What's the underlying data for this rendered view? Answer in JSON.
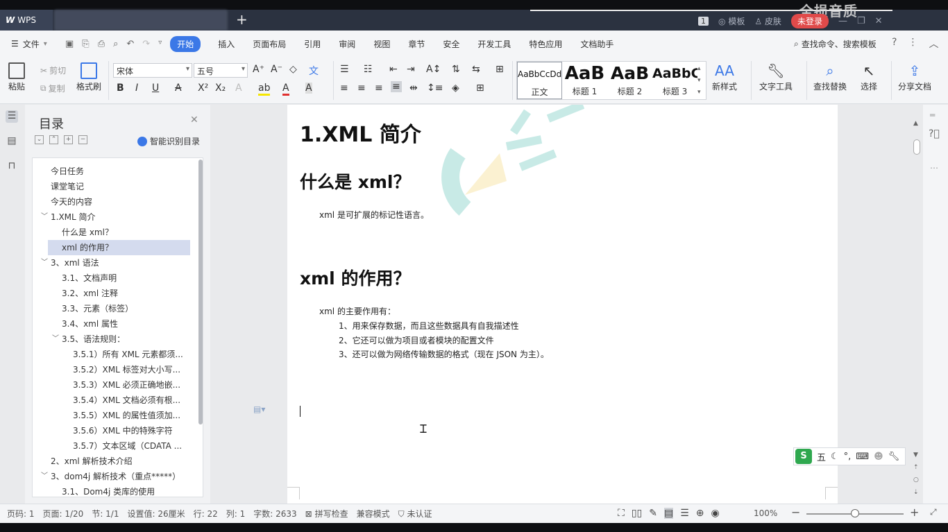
{
  "titlebar": {
    "app_tab": "WPS",
    "watermark": "全损音质",
    "page_badge": "1",
    "template_label": "模板",
    "skin_label": "皮肤",
    "login_label": "未登录"
  },
  "menubar": {
    "file_label": "文件",
    "tabs": [
      "开始",
      "插入",
      "页面布局",
      "引用",
      "审阅",
      "视图",
      "章节",
      "安全",
      "开发工具",
      "特色应用",
      "文档助手"
    ],
    "search_label": "查找命令、搜索模板"
  },
  "ribbon": {
    "paste": "粘贴",
    "cut": "剪切",
    "copy": "复制",
    "format_painter": "格式刷",
    "font_name": "宋体",
    "font_size": "五号",
    "styles": [
      {
        "sample": "AaBbCcDd",
        "label": "正文"
      },
      {
        "sample": "AaB",
        "label": "标题 1"
      },
      {
        "sample": "AaB",
        "label": "标题 2"
      },
      {
        "sample": "AaBbC",
        "label": "标题 3"
      }
    ],
    "new_style": "新样式",
    "text_tools": "文字工具",
    "find_replace": "查找替换",
    "select": "选择",
    "share_doc": "分享文档"
  },
  "toc": {
    "title": "目录",
    "smart_label": "智能识别目录",
    "items": [
      {
        "label": "今日任务",
        "level": 0,
        "chev": ""
      },
      {
        "label": "课堂笔记",
        "level": 0,
        "chev": ""
      },
      {
        "label": "今天的内容",
        "level": 0,
        "chev": ""
      },
      {
        "label": "1.XML 简介",
        "level": 0,
        "chev": "﹀"
      },
      {
        "label": "什么是 xml？",
        "level": 1,
        "chev": ""
      },
      {
        "label": "xml 的作用？",
        "level": 1,
        "chev": "",
        "selected": true
      },
      {
        "label": "3、xml 语法",
        "level": 0,
        "chev": "﹀"
      },
      {
        "label": "3.1、文档声明",
        "level": 1,
        "chev": ""
      },
      {
        "label": "3.2、xml 注释",
        "level": 1,
        "chev": ""
      },
      {
        "label": "3.3、元素（标签）",
        "level": 1,
        "chev": ""
      },
      {
        "label": "3.4、xml 属性",
        "level": 1,
        "chev": ""
      },
      {
        "label": "3.5、语法规则：",
        "level": 1,
        "chev": "﹀"
      },
      {
        "label": "3.5.1）所有 XML 元素都须...",
        "level": 2,
        "chev": ""
      },
      {
        "label": "3.5.2）XML 标签对大小写...",
        "level": 2,
        "chev": ""
      },
      {
        "label": "3.5.3）XML 必须正确地嵌...",
        "level": 2,
        "chev": ""
      },
      {
        "label": "3.5.4）XML 文档必须有根...",
        "level": 2,
        "chev": ""
      },
      {
        "label": "3.5.5）XML 的属性值须加...",
        "level": 2,
        "chev": ""
      },
      {
        "label": "3.5.6）XML 中的特殊字符",
        "level": 2,
        "chev": ""
      },
      {
        "label": "3.5.7）文本区域（CDATA ...",
        "level": 2,
        "chev": ""
      },
      {
        "label": "2、xml 解析技术介绍",
        "level": 0,
        "chev": ""
      },
      {
        "label": "3、dom4j 解析技术（重点*****）",
        "level": 0,
        "chev": "﹀"
      },
      {
        "label": "3.1、Dom4j 类库的使用",
        "level": 1,
        "chev": ""
      }
    ]
  },
  "document": {
    "h1": "1.XML 简介",
    "h2_what": "什么是 xml？",
    "p_what": "xml 是可扩展的标记性语言。",
    "h2_use": "xml 的作用？",
    "p_use_intro": "xml 的主要作用有：",
    "uses": [
      "1、用来保存数据，而且这些数据具有自我描述性",
      "2、它还可以做为项目或者模块的配置文件",
      "3、还可以做为网络传输数据的格式（现在 JSON 为主）。"
    ]
  },
  "ime": {
    "mode": "五"
  },
  "statusbar": {
    "page_no": "页码: 1",
    "page": "页面: 1/20",
    "section": "节: 1/1",
    "setting": "设置值: 26厘米",
    "row": "行: 22",
    "col": "列: 1",
    "words": "字数: 2633",
    "spell": "拼写检查",
    "compat": "兼容模式",
    "cert": "未认证",
    "zoom": "100%"
  }
}
